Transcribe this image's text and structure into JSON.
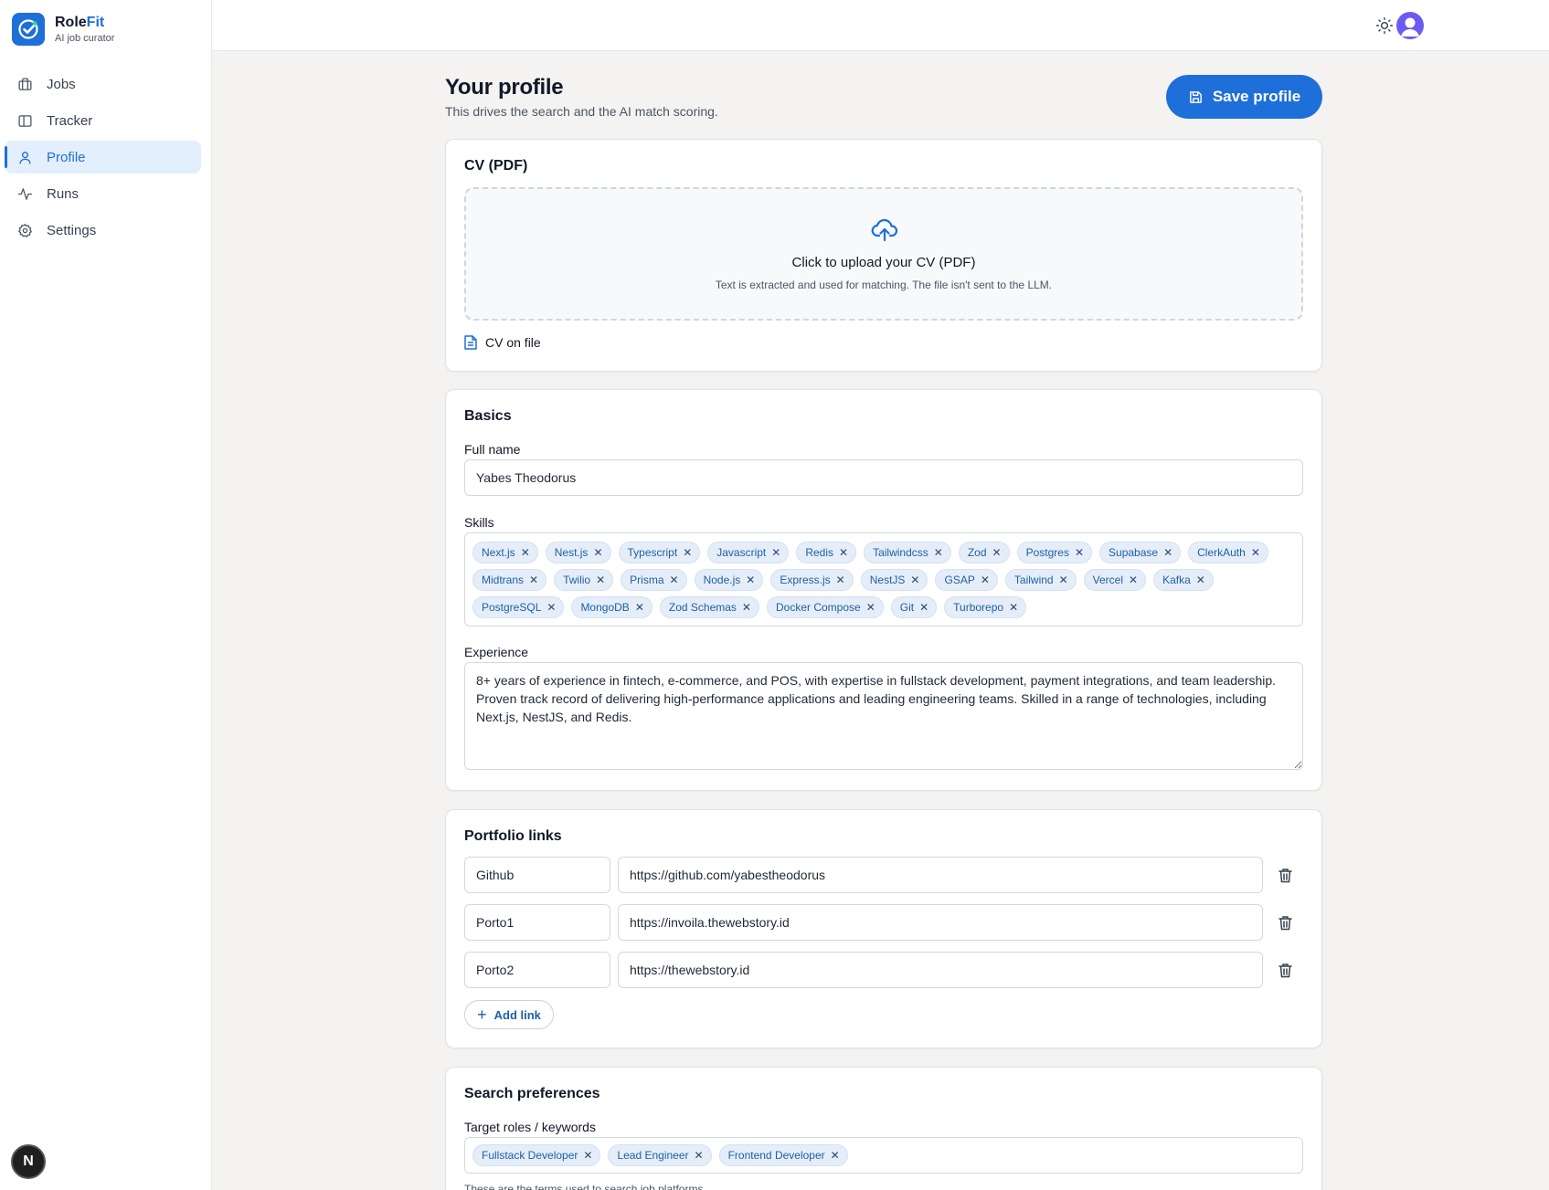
{
  "brand": {
    "name_prefix": "Role",
    "name_accent": "Fit",
    "subtitle": "AI job curator",
    "accent_color": "#1e6fd9"
  },
  "nav": {
    "items": [
      {
        "label": "Jobs",
        "icon": "briefcase-icon",
        "active": false
      },
      {
        "label": "Tracker",
        "icon": "columns-icon",
        "active": false
      },
      {
        "label": "Profile",
        "icon": "user-icon",
        "active": true
      },
      {
        "label": "Runs",
        "icon": "activity-icon",
        "active": false
      },
      {
        "label": "Settings",
        "icon": "gear-icon",
        "active": false
      }
    ]
  },
  "dev_badge": "N",
  "topbar": {
    "theme_icon": "sun-icon",
    "avatar_icon": "user-avatar-icon",
    "avatar_color": "#6a5cf2"
  },
  "page": {
    "title": "Your profile",
    "subtitle": "This drives the search and the AI match scoring.",
    "save_label": "Save profile"
  },
  "cv": {
    "title": "CV (PDF)",
    "upload_title": "Click to upload your CV (PDF)",
    "upload_hint": "Text is extracted and used for matching. The file isn't sent to the LLM.",
    "on_file_label": "CV on file"
  },
  "basics": {
    "title": "Basics",
    "full_name_label": "Full name",
    "full_name_value": "Yabes Theodorus",
    "skills_label": "Skills",
    "skills": [
      "Next.js",
      "Nest.js",
      "Typescript",
      "Javascript",
      "Redis",
      "Tailwindcss",
      "Zod",
      "Postgres",
      "Supabase",
      "ClerkAuth",
      "Midtrans",
      "Twilio",
      "Prisma",
      "Node.js",
      "Express.js",
      "NestJS",
      "GSAP",
      "Tailwind",
      "Vercel",
      "Kafka",
      "PostgreSQL",
      "MongoDB",
      "Zod Schemas",
      "Docker Compose",
      "Git",
      "Turborepo"
    ],
    "experience_label": "Experience",
    "experience_value": "8+ years of experience in fintech, e-commerce, and POS, with expertise in fullstack development, payment integrations, and team leadership. Proven track record of delivering high-performance applications and leading engineering teams. Skilled in a range of technologies, including Next.js, NestJS, and Redis."
  },
  "portfolio": {
    "title": "Portfolio links",
    "links": [
      {
        "label": "Github",
        "url": "https://github.com/yabestheodorus"
      },
      {
        "label": "Porto1",
        "url": "https://invoila.thewebstory.id"
      },
      {
        "label": "Porto2",
        "url": "https://thewebstory.id"
      }
    ],
    "add_label": "Add link"
  },
  "search": {
    "title": "Search preferences",
    "roles_label": "Target roles / keywords",
    "roles": [
      "Fullstack Developer",
      "Lead Engineer",
      "Frontend Developer"
    ],
    "hint": "These are the terms used to search job platforms."
  }
}
